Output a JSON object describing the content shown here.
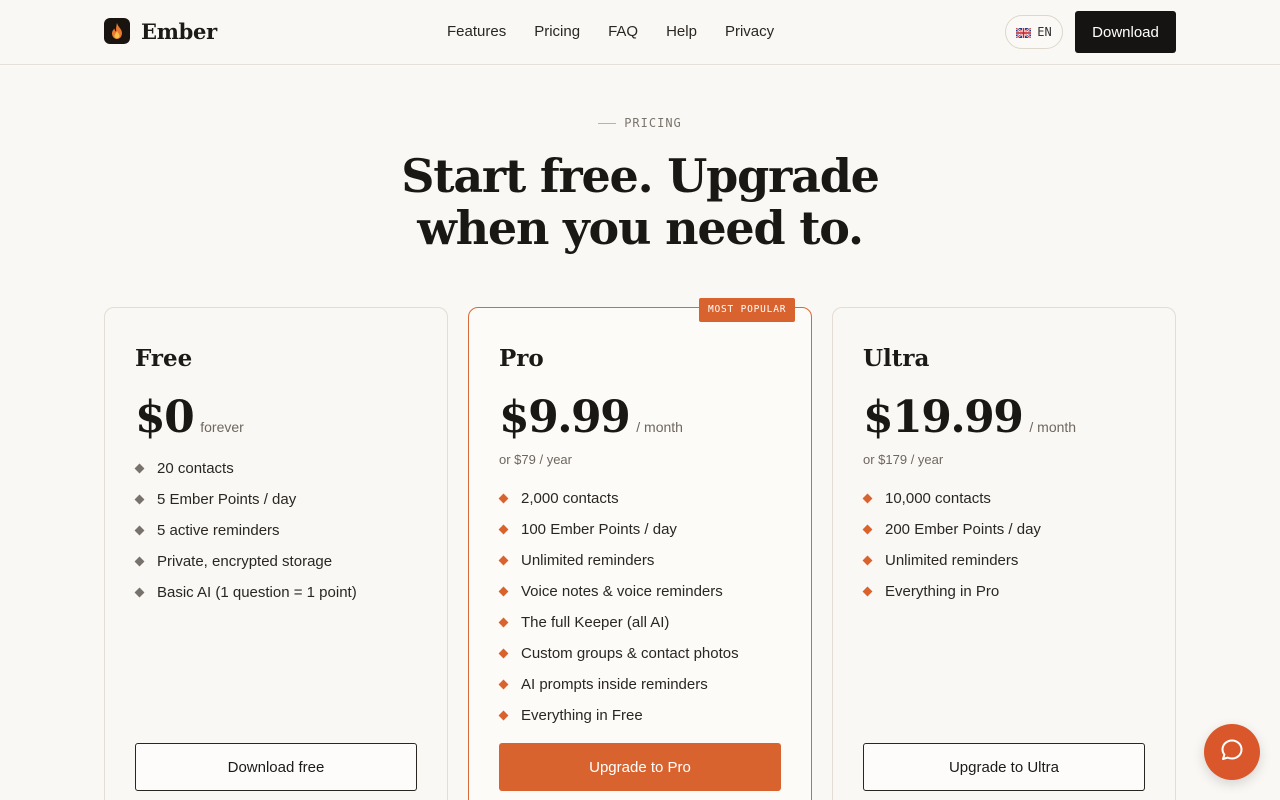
{
  "brand": {
    "name": "Ember",
    "accent": "#d9632f"
  },
  "nav": {
    "items": [
      {
        "label": "Features"
      },
      {
        "label": "Pricing"
      },
      {
        "label": "FAQ"
      },
      {
        "label": "Help"
      },
      {
        "label": "Privacy"
      }
    ]
  },
  "header": {
    "language": "EN",
    "download_label": "Download"
  },
  "hero": {
    "eyebrow": "PRICING",
    "title_line1": "Start free. Upgrade",
    "title_line2": "when you need to."
  },
  "plans": [
    {
      "name": "Free",
      "price": "$0",
      "period": "forever",
      "alt_price": "",
      "features": [
        "20 contacts",
        "5 Ember Points / day",
        "5 active reminders",
        "Private, encrypted storage",
        "Basic AI (1 question = 1 point)"
      ],
      "cta": "Download free"
    },
    {
      "name": "Pro",
      "badge": "MOST POPULAR",
      "price": "$9.99",
      "period": "/ month",
      "alt_price": "or $79 / year",
      "features": [
        "2,000 contacts",
        "100 Ember Points / day",
        "Unlimited reminders",
        "Voice notes & voice reminders",
        "The full Keeper (all AI)",
        "Custom groups & contact photos",
        "AI prompts inside reminders",
        "Everything in Free"
      ],
      "cta": "Upgrade to Pro"
    },
    {
      "name": "Ultra",
      "price": "$19.99",
      "period": "/ month",
      "alt_price": "or $179 / year",
      "features": [
        "10,000 contacts",
        "200 Ember Points / day",
        "Unlimited reminders",
        "Everything in Pro"
      ],
      "cta": "Upgrade to Ultra"
    }
  ],
  "chat": {
    "icon": "chat-bubble-icon"
  }
}
